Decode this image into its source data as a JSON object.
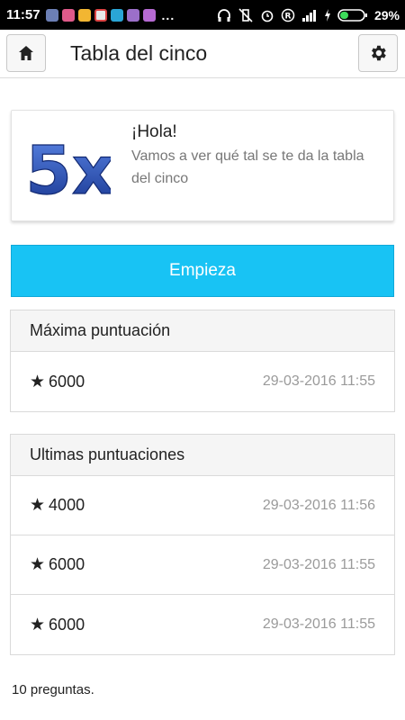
{
  "status_bar": {
    "time": "11:57",
    "battery": "29%",
    "overflow": "..."
  },
  "header": {
    "title": "Tabla del cinco",
    "home_icon": "home-icon",
    "settings_icon": "gear-icon"
  },
  "intro": {
    "logo_text": "5x",
    "greeting": "¡Hola!",
    "message": "Vamos a ver qué tal se te da la tabla del cinco"
  },
  "start_button": {
    "label": "Empieza",
    "color": "#18c3f4"
  },
  "best_scores": {
    "title": "Máxima puntuación",
    "rows": [
      {
        "star": "★",
        "score": "6000",
        "date": "29-03-2016 11:55"
      }
    ]
  },
  "recent_scores": {
    "title": "Ultimas puntuaciones",
    "rows": [
      {
        "star": "★",
        "score": "4000",
        "date": "29-03-2016 11:56"
      },
      {
        "star": "★",
        "score": "6000",
        "date": "29-03-2016 11:55"
      },
      {
        "star": "★",
        "score": "6000",
        "date": "29-03-2016 11:55"
      }
    ]
  },
  "footer": {
    "note": "10 preguntas."
  }
}
